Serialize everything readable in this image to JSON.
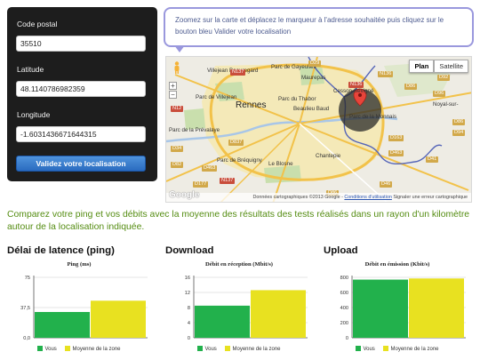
{
  "form": {
    "postal_label": "Code postal",
    "postal_value": "35510",
    "lat_label": "Latitude",
    "lat_value": "48.1140786982359",
    "lon_label": "Longitude",
    "lon_value": "-1.6031436671644315",
    "submit_label": "Validez votre localisation"
  },
  "tooltip": "Zoomez sur la carte et déplacez le marqueur à l'adresse souhaitée puis cliquez sur le bouton bleu Valider votre localisation",
  "map": {
    "types": [
      "Plan",
      "Satellite"
    ],
    "active_type": "Plan",
    "zoom_in": "+",
    "zoom_out": "−",
    "logo": "Google",
    "attribution": "Données cartographiques ©2013 Google -",
    "terms_link": "Conditions d'utilisation",
    "report_link": "Signaler une erreur cartographique",
    "labels": {
      "city": "Rennes",
      "villejean": "Villejean Beauregard",
      "gayeulles": "Parc de Gayeulles",
      "villejean_park": "Parc de Villejean",
      "thabor": "Parc du Thabor",
      "beaulieu": "Beaulieu Baud",
      "cesson": "Cesson-Sévigné",
      "parc_monnais": "Parc de la Monnais",
      "prevalaye": "Parc de la Prévalaye",
      "chantepie": "Chantepie",
      "le_blosne": "Le Blosne",
      "parc_brequigny": "Parc de Bréquigny",
      "noyal": "Noyal-sur-",
      "maurepas": "Maurepas"
    },
    "roads": [
      "N137",
      "D29",
      "N136",
      "N12",
      "D86",
      "D96",
      "D92",
      "D837",
      "D86",
      "D34",
      "D163",
      "D463",
      "D82",
      "D463",
      "D177",
      "N137",
      "D41",
      "D46",
      "D86",
      "N136",
      "D94"
    ]
  },
  "intro": "Comparez votre ping et vos débits avec la moyenne des résultats des tests réalisés dans un rayon d'un kilomètre autour de la localisation indiquée.",
  "charts": [
    {
      "section_title": "Délai de latence (ping)",
      "chart_data": {
        "type": "bar",
        "title": "Ping (ms)",
        "categories": [
          "Vous",
          "Moyenne de la zone"
        ],
        "values": [
          32,
          46
        ],
        "ylim": [
          0,
          75
        ],
        "yticks": [
          "75",
          "37,5",
          "0,0"
        ],
        "ytick_vals": [
          75,
          37.5,
          0
        ],
        "colors": [
          "#22b14c",
          "#e8e120"
        ],
        "legend": [
          "Vous",
          "Moyenne de la zone"
        ]
      }
    },
    {
      "section_title": "Download",
      "chart_data": {
        "type": "bar",
        "title": "Débit en réception (Mbit/s)",
        "categories": [
          "Vous",
          "Moyenne de la zone"
        ],
        "values": [
          8.5,
          12.6
        ],
        "ylim": [
          0,
          16
        ],
        "yticks": [
          "16",
          "12",
          "8",
          "4",
          "0"
        ],
        "ytick_vals": [
          16,
          12,
          8,
          4,
          0
        ],
        "colors": [
          "#22b14c",
          "#e8e120"
        ],
        "legend": [
          "Vous",
          "Moyenne de la zone"
        ]
      }
    },
    {
      "section_title": "Upload",
      "chart_data": {
        "type": "bar",
        "title": "Débit en émission (Kbit/s)",
        "categories": [
          "Vous",
          "Moyenne de la zone"
        ],
        "values": [
          770,
          785
        ],
        "ylim": [
          0,
          800
        ],
        "yticks": [
          "800",
          "600",
          "400",
          "200",
          "0"
        ],
        "ytick_vals": [
          800,
          600,
          400,
          200,
          0
        ],
        "colors": [
          "#22b14c",
          "#e8e120"
        ],
        "legend": [
          "Vous",
          "Moyenne de la zone"
        ]
      }
    }
  ]
}
